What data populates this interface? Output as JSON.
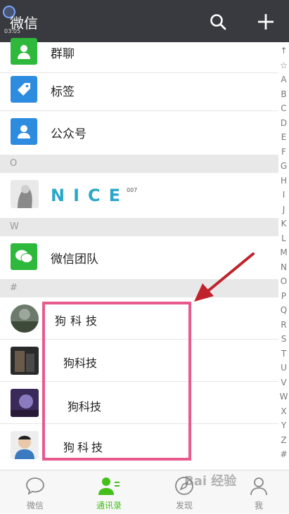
{
  "header": {
    "title": "微信",
    "time": "03:05"
  },
  "rows": {
    "groupchat": "群聊",
    "tags": "标签",
    "official": "公众号",
    "wechat_team": "微信团队"
  },
  "sections": {
    "o": "O",
    "w": "W",
    "hash": "#"
  },
  "contacts": {
    "nice_name": "NICE",
    "nice_sup": "007",
    "c1": "狗科技",
    "c2": "狗科技",
    "c3": "狗科技",
    "c4": "狗科技"
  },
  "alphabet": [
    "↑",
    "☆",
    "A",
    "B",
    "C",
    "D",
    "E",
    "F",
    "G",
    "H",
    "I",
    "J",
    "K",
    "L",
    "M",
    "N",
    "O",
    "P",
    "Q",
    "R",
    "S",
    "T",
    "U",
    "V",
    "W",
    "X",
    "Y",
    "Z",
    "#"
  ],
  "tabs": [
    {
      "label": "微信"
    },
    {
      "label": "通讯录"
    },
    {
      "label": "发现"
    },
    {
      "label": "我"
    }
  ],
  "colors": {
    "accent": "#45c01a",
    "highlight": "#e85a8d",
    "arrow": "#c0232b",
    "header": "#393a3f"
  },
  "watermark": "Bai 经验"
}
